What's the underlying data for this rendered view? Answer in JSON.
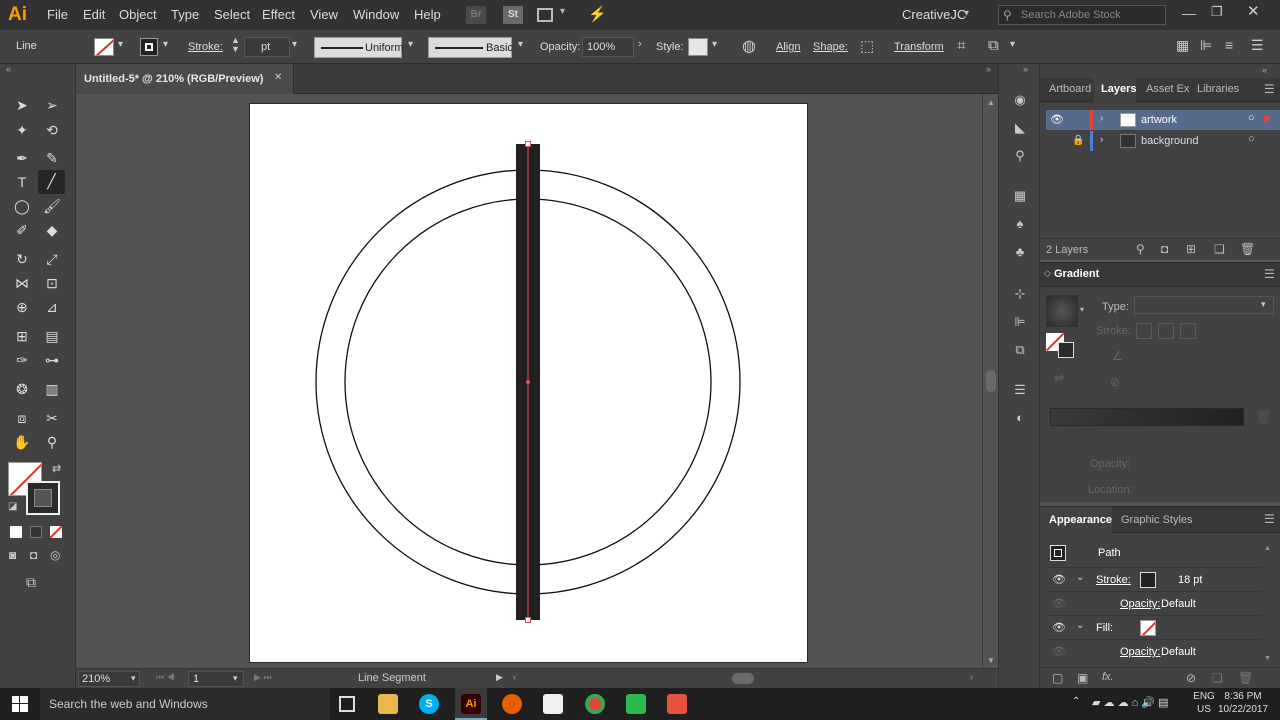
{
  "app": {
    "logo": "Ai",
    "user": "CreativeJC",
    "search_placeholder": "Search Adobe Stock"
  },
  "menu": [
    "File",
    "Edit",
    "Object",
    "Type",
    "Select",
    "Effect",
    "View",
    "Window",
    "Help"
  ],
  "menu_icons": {
    "br": "Br",
    "st": "St"
  },
  "control": {
    "selection_label": "Line",
    "stroke_label": "Stroke:",
    "stroke_value": "pt",
    "profile_label": "Uniform",
    "brush_label": "Basic",
    "opacity_label": "Opacity:",
    "opacity_value": "100%",
    "style_label": "Style:",
    "align_label": "Align",
    "shape_label": "Shape:",
    "transform_label": "Transform"
  },
  "document": {
    "tab_title": "Untitled-5* @ 210% (RGB/Preview)",
    "tab_close": "✕"
  },
  "layers_panel": {
    "tabs": [
      "Artboard",
      "Layers",
      "Asset Exp",
      "Libraries"
    ],
    "active_tab": "Layers",
    "layers": [
      {
        "name": "artwork",
        "color": "#e0443c",
        "selected": true
      },
      {
        "name": "background",
        "color": "#4a7fd8",
        "selected": false
      }
    ],
    "count": "2 Layers"
  },
  "gradient_panel": {
    "title": "Gradient",
    "type_label": "Type:",
    "stroke_label": "Stroke:",
    "opacity_label": "Opacity:",
    "location_label": "Location:"
  },
  "appearance_panel": {
    "tabs": [
      "Appearance",
      "Graphic Styles"
    ],
    "object": "Path",
    "stroke_label": "Stroke:",
    "stroke_value": "18 pt",
    "opacity_label": "Opacity:",
    "opacity_value": "Default",
    "fill_label": "Fill:",
    "fill_opacity_label": "Opacity:",
    "fill_opacity_value": "Default",
    "fx_label": "fx."
  },
  "status": {
    "zoom": "210%",
    "artboard_num": "1",
    "tool_info": "Line Segment"
  },
  "taskbar": {
    "search": "Search the web and Windows",
    "lang": "ENG",
    "region": "US",
    "time": "8:36 PM",
    "date": "10/22/2017"
  },
  "colors": {
    "accent": "#ff9a00",
    "selection": "#e05060",
    "rect_fill": "#231f20",
    "layer_selected": "#566a8c"
  }
}
